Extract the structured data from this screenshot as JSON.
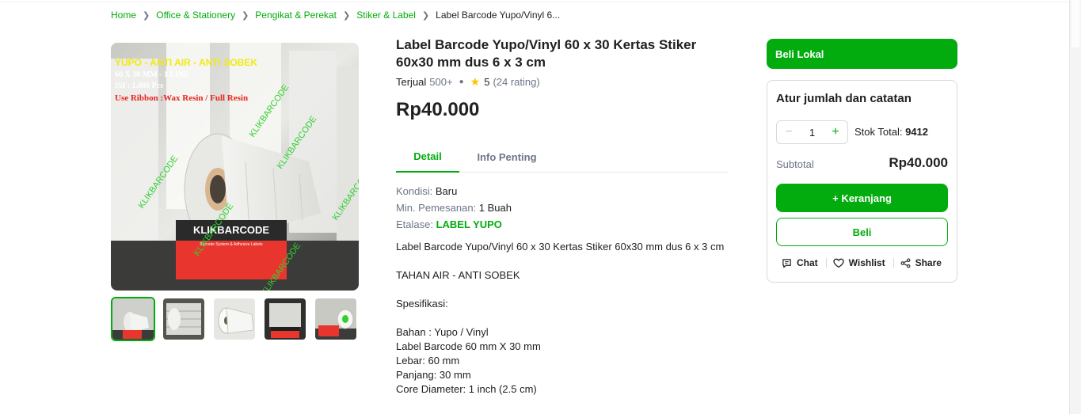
{
  "breadcrumb": {
    "items": [
      "Home",
      "Office & Stationery",
      "Pengikat & Perekat",
      "Stiker & Label"
    ],
    "current": "Label Barcode Yupo/Vinyl 6..."
  },
  "gallery": {
    "image_text": {
      "line1": "YUPO - ANTI AIR - ANTI SOBEK",
      "line2": "60 X 30 MM - 1 LINE",
      "line3": "ISI : 1.000 Pcs",
      "line4": "Use Ribbon :Wax Resin / Full Resin",
      "watermark": "KLIKBARCODE",
      "box_brand": "KLIKBARCODE",
      "box_sub": "Barcode System & Adhesive Labels"
    }
  },
  "product": {
    "title": "Label Barcode Yupo/Vinyl 60 x 30 Kertas Stiker 60x30 mm dus 6 x 3 cm",
    "sold_label": "Terjual",
    "sold_count": "500+",
    "rating": "5",
    "rating_count": "(24 rating)",
    "price": "Rp40.000"
  },
  "tabs": [
    "Detail",
    "Info Penting"
  ],
  "specs": {
    "kondisi_label": "Kondisi: ",
    "kondisi_value": "Baru",
    "min_label": "Min. Pemesanan: ",
    "min_value": "1 Buah",
    "etalase_label": "Etalase: ",
    "etalase_value": "LABEL YUPO"
  },
  "description": {
    "lines": [
      "Label Barcode Yupo/Vinyl 60 x 30 Kertas Stiker 60x30 mm dus 6 x 3 cm",
      "",
      "TAHAN AIR - ANTI SOBEK",
      "",
      "Spesifikasi:",
      "",
      "Bahan : Yupo / Vinyl",
      "Label Barcode 60 mm X 30 mm",
      "Lebar: 60 mm",
      "Panjang: 30 mm",
      "Core Diameter: 1 inch (2.5 cm)"
    ]
  },
  "purchase": {
    "shipping_label": "Beli Lokal",
    "card_title": "Atur jumlah dan catatan",
    "quantity": "1",
    "stock_label": "Stok Total: ",
    "stock_value": "9412",
    "subtotal_label": "Subtotal",
    "subtotal_value": "Rp40.000",
    "cart_button": "+ Keranjang",
    "buy_button": "Beli",
    "chat": "Chat",
    "wishlist": "Wishlist",
    "share": "Share"
  },
  "colors": {
    "accent": "#03ac0e",
    "star": "#ffc400",
    "muted": "#6d7588"
  }
}
